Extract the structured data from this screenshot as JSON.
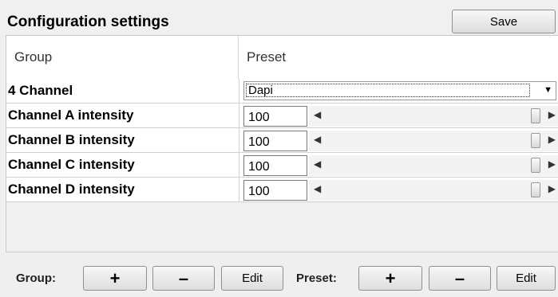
{
  "header": {
    "title": "Configuration settings",
    "save_label": "Save"
  },
  "table": {
    "columns": {
      "group": "Group",
      "preset": "Preset"
    },
    "preset_row": {
      "label": "4 Channel",
      "value": "Dapi"
    },
    "intensity_rows": [
      {
        "label": "Channel A intensity",
        "value": "100"
      },
      {
        "label": "Channel B intensity",
        "value": "100"
      },
      {
        "label": "Channel C intensity",
        "value": "100"
      },
      {
        "label": "Channel D intensity",
        "value": "100"
      }
    ]
  },
  "footer": {
    "group_label": "Group:",
    "preset_label": "Preset:",
    "add_label": "+",
    "remove_label": "–",
    "edit_label": "Edit"
  }
}
